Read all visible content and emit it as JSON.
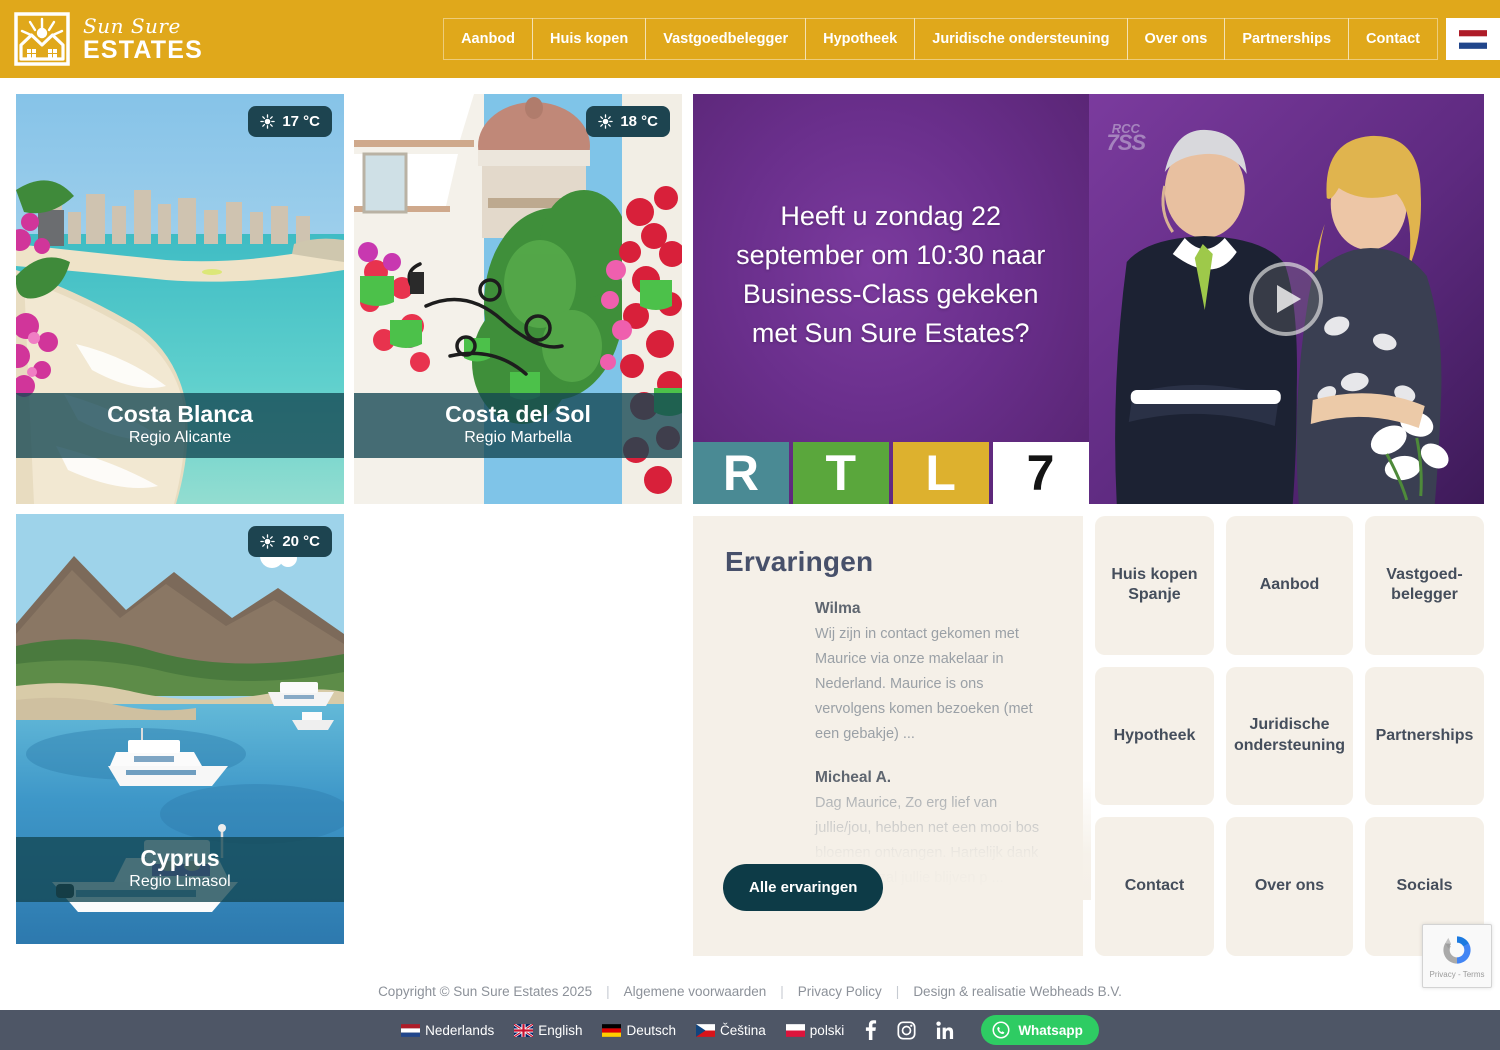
{
  "header": {
    "brand_script": "Sun Sure",
    "brand_name": "ESTATES",
    "logo_icon": "house-sun-icon",
    "nav": [
      {
        "label": "Aanbod"
      },
      {
        "label": "Huis kopen"
      },
      {
        "label": "Vastgoedbelegger"
      },
      {
        "label": "Hypotheek"
      },
      {
        "label": "Juridische ondersteuning"
      },
      {
        "label": "Over ons"
      },
      {
        "label": "Partnerships"
      },
      {
        "label": "Contact"
      }
    ],
    "flag_label": "Nederlands",
    "accent_color": "#e0a81b"
  },
  "regions": [
    {
      "title": "Costa Blanca",
      "subtitle": "Regio Alicante",
      "temp": "17 °C",
      "weather_icon": "sun-icon"
    },
    {
      "title": "Costa del Sol",
      "subtitle": "Regio Marbella",
      "temp": "18 °C",
      "weather_icon": "sun-icon"
    },
    {
      "title": "Cyprus",
      "subtitle": "Regio Limasol",
      "temp": "20 °C",
      "weather_icon": "sun-icon"
    }
  ],
  "promo": {
    "headline": "Heeft u zondag 22 september om 10:30 naar Business-Class gekeken met Sun Sure Estates?",
    "watermark_top": "RCC",
    "watermark_bottom": "7SS",
    "play_icon": "play-icon",
    "rtl": [
      {
        "letter": "R",
        "color": "#4a8a94",
        "text_color": "#ffffff"
      },
      {
        "letter": "T",
        "color": "#5aa73c",
        "text_color": "#ffffff"
      },
      {
        "letter": "L",
        "color": "#ddb12e",
        "text_color": "#ffffff"
      },
      {
        "letter": "7",
        "color": "#ffffff",
        "text_color": "#141414"
      }
    ]
  },
  "testimonials": {
    "heading": "Ervaringen",
    "items": [
      {
        "name": "Wilma",
        "text": "Wij zijn in contact gekomen met Maurice via onze makelaar in Nederland. Maurice is ons vervolgens komen bezoeken (met een gebakje) ..."
      },
      {
        "name": "Micheal A.",
        "text": "Dag Maurice, Zo erg lief van jullie/jou, hebben net een mooi bos bloemen ontvangen. Hartelijk dank ervoor. Ik zal jullie blijven p ..."
      }
    ],
    "button_label": "Alle ervaringen"
  },
  "quick_links": [
    {
      "label": "Huis kopen Spanje"
    },
    {
      "label": "Aanbod"
    },
    {
      "label": "Vastgoed-belegger"
    },
    {
      "label": "Hypotheek"
    },
    {
      "label": "Juridische ondersteuning"
    },
    {
      "label": "Partnerships"
    },
    {
      "label": "Contact"
    },
    {
      "label": "Over ons"
    },
    {
      "label": "Socials"
    }
  ],
  "footer": {
    "copyright": "Copyright © Sun Sure Estates 2025",
    "links": [
      {
        "label": "Algemene voorwaarden"
      },
      {
        "label": "Privacy Policy"
      },
      {
        "label": "Design & realisatie Webheads B.V."
      }
    ],
    "languages": [
      {
        "label": "Nederlands",
        "flag": "nl"
      },
      {
        "label": "English",
        "flag": "gb"
      },
      {
        "label": "Deutsch",
        "flag": "de"
      },
      {
        "label": "Čeština",
        "flag": "cz"
      },
      {
        "label": "polski",
        "flag": "pl"
      }
    ],
    "socials": [
      {
        "name": "facebook-icon",
        "glyph": "f"
      },
      {
        "name": "instagram-icon",
        "glyph": ""
      },
      {
        "name": "linkedin-icon",
        "glyph": "in"
      }
    ],
    "whatsapp_label": "Whatsapp",
    "whatsapp_color": "#2ecc63"
  },
  "recaptcha": {
    "label": "Privacy - Terms"
  }
}
